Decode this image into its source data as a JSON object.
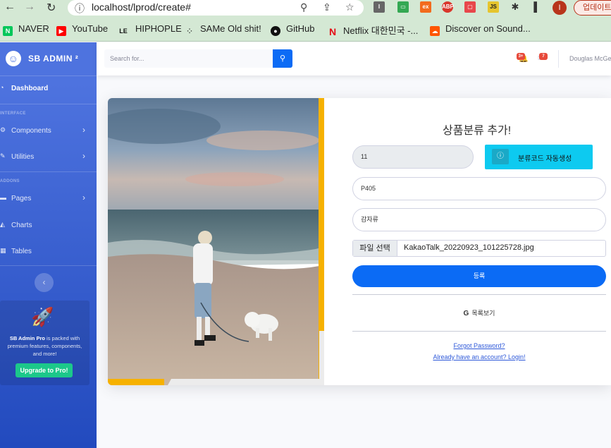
{
  "browser": {
    "url": "localhost/lprod/create#",
    "profile_initial": "I",
    "update_label": "업데이트"
  },
  "bookmarks": [
    {
      "label": "NAVER",
      "icon": "naver-icon",
      "color": "#03c75a"
    },
    {
      "label": "YouTube",
      "icon": "youtube-icon",
      "color": "#ff0000"
    },
    {
      "label": "HIPHOPLE",
      "icon": "hiphople-icon",
      "color": "#111111"
    },
    {
      "label": "SAMe Old shit!",
      "icon": "same-icon",
      "color": "#222222"
    },
    {
      "label": "GitHub",
      "icon": "github-icon",
      "color": "#111111"
    },
    {
      "label": "Netflix 대한민국 -...",
      "icon": "netflix-icon",
      "color": "#e50914"
    },
    {
      "label": "Discover on Sound...",
      "icon": "soundcloud-icon",
      "color": "#ff5500"
    }
  ],
  "sidebar": {
    "brand": "SB ADMIN ²",
    "brand_logo": "☺",
    "dashboard": "Dashboard",
    "heading_interface": "INTERFACE",
    "components": "Components",
    "utilities": "Utilities",
    "heading_addons": "ADDONS",
    "pages": "Pages",
    "charts": "Charts",
    "tables": "Tables",
    "promo_title": "SB Admin Pro",
    "promo_body": " is packed with premium features, components, and more!",
    "promo_button": "Upgrade to Pro!"
  },
  "topbar": {
    "search_placeholder": "Search for...",
    "alerts_badge": "3+",
    "messages_badge": "7",
    "user_name": "Douglas McGee"
  },
  "form": {
    "title": "상품분류 추가!",
    "code_value": "11",
    "generate_button": "분류코드 자동생성",
    "lprod_id": "P405",
    "lprod_name": "감자류",
    "file_button": "파일 선택",
    "file_name": "KakaoTalk_20220923_101225728.jpg",
    "submit_label": "등록",
    "list_link": "목록보기",
    "forgot_password": "Forgot Password?",
    "login_link": "Already have an account? Login!"
  },
  "colors": {
    "primary": "#0b6bf5",
    "sidebar": "#4e73df",
    "info": "#0dcaf0",
    "success": "#1cc88a",
    "danger": "#e74a3b",
    "accent": "#f6b100"
  }
}
